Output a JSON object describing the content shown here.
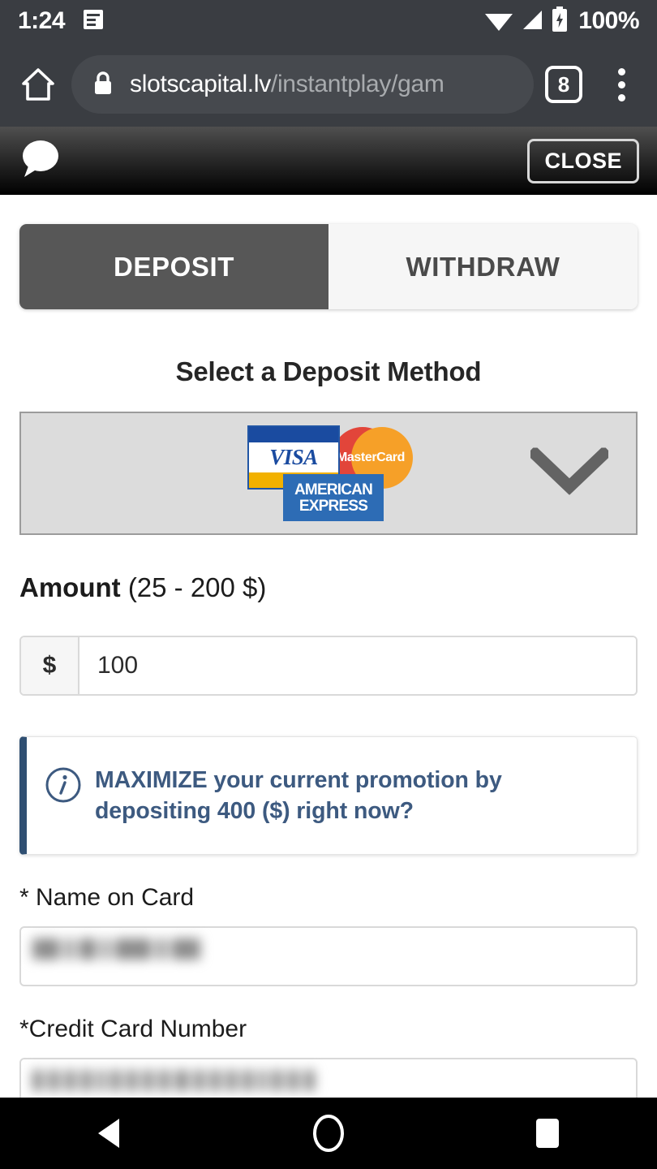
{
  "status_bar": {
    "time": "1:24",
    "battery_percent": "100%",
    "notification_icon": "document-notification-icon",
    "wifi_icon": "wifi-icon",
    "signal_icon": "cellular-signal-icon",
    "battery_icon": "battery-charging-icon"
  },
  "browser": {
    "home_icon": "home-icon",
    "lock_icon": "lock-secure-icon",
    "url_domain": "slotscapital.lv",
    "url_path": "/instantplay/gam",
    "tab_count": "8",
    "overflow_icon": "three-dot-menu-icon"
  },
  "game_toolbar": {
    "chat_icon": "chat-bubble-icon",
    "close_label": "CLOSE"
  },
  "cashier": {
    "tabs": [
      {
        "label": "DEPOSIT",
        "active": true
      },
      {
        "label": "WITHDRAW",
        "active": false
      }
    ],
    "heading": "Select a Deposit Method",
    "method_select": {
      "chevron_icon": "chevron-down-icon",
      "logos": [
        "visa-logo",
        "mastercard-logo",
        "american-express-logo"
      ],
      "visa_text": "VISA",
      "mastercard_text": "MasterCard",
      "amex_line1": "AMERICAN",
      "amex_line2": "EXPRESS"
    },
    "amount": {
      "label_bold": "Amount",
      "label_range": "(25 - 200 $)",
      "currency_symbol": "$",
      "value": "100"
    },
    "promo_alert": {
      "icon": "info-circle-icon",
      "text": "MAXIMIZE your current promotion by depositing 400 ($) right now?"
    },
    "fields": [
      {
        "label": "* Name on Card",
        "value": "",
        "redacted": true
      },
      {
        "label": "*Credit Card Number",
        "value": "",
        "redacted": true
      }
    ]
  },
  "nav_bar": {
    "back_icon": "back-triangle-icon",
    "home_icon": "home-circle-icon",
    "recents_icon": "recents-square-icon"
  },
  "colors": {
    "status_bg": "#3a3d42",
    "tab_active": "#575757",
    "tab_inactive": "#f6f6f6",
    "alert_accent": "#2f4f72",
    "alert_text": "#3d5a80",
    "visa_blue": "#1a4ba0",
    "visa_gold": "#f2b100",
    "mc_red": "#e2453a",
    "mc_orange": "#f6a028",
    "amex_blue": "#2d6cb5"
  }
}
